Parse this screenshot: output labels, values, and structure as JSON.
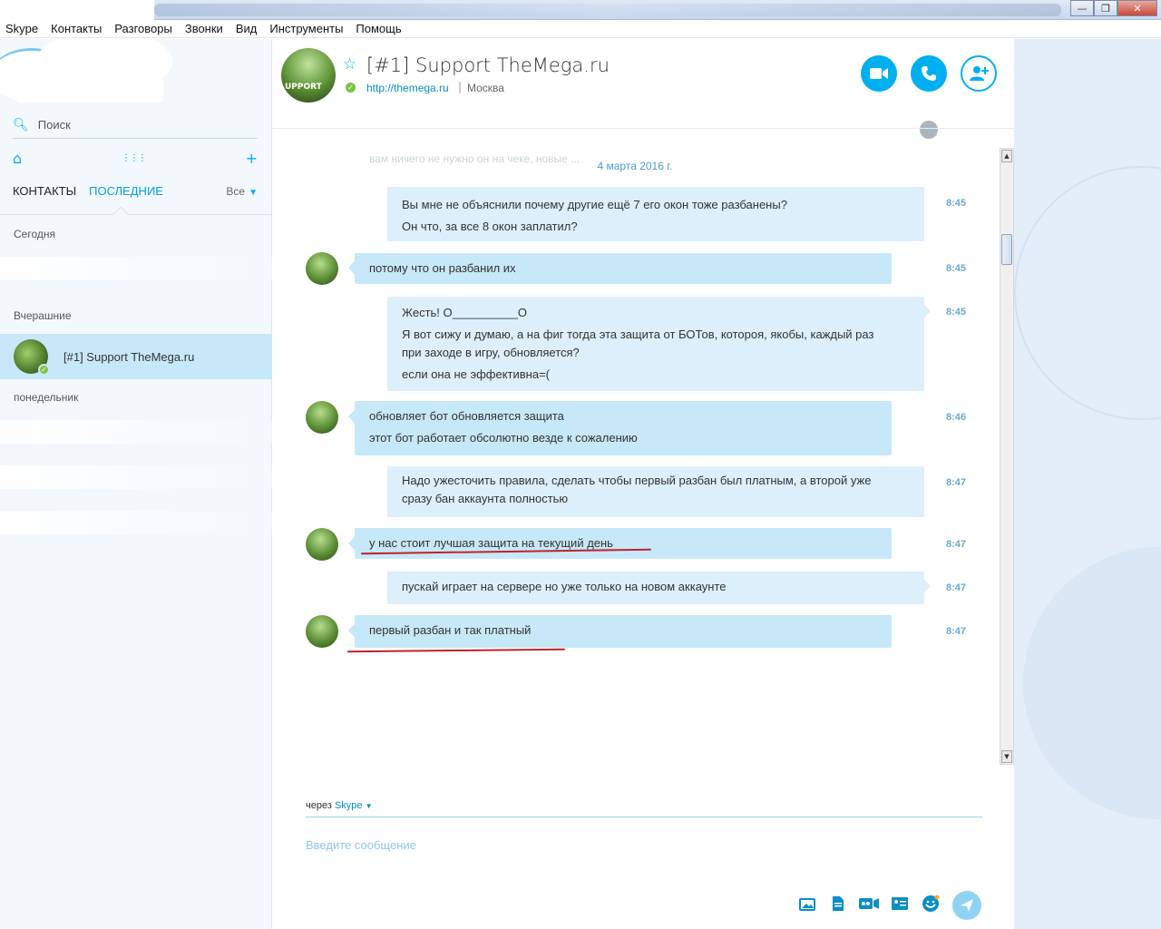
{
  "menu": [
    "Skype",
    "Контакты",
    "Разговоры",
    "Звонки",
    "Вид",
    "Инструменты",
    "Помощь"
  ],
  "window_buttons": {
    "minimize": "—",
    "restore": "❐",
    "close": "✕"
  },
  "sidebar": {
    "search_label": "Поиск",
    "tabs": [
      "КОНТАКТЫ",
      "ПОСЛЕДНИЕ"
    ],
    "active_tab": "ПОСЛЕДНИЕ",
    "filter": "Все",
    "groups": {
      "today": "Сегодня",
      "yesterday": "Вчерашние",
      "monday": "понедельник"
    },
    "selected_chat": {
      "name": "[#1] Support TheMega.ru"
    }
  },
  "header": {
    "title": "[#1] Support TheMega.ru",
    "link": "http://themega.ru",
    "separator": "|",
    "city": "Москва",
    "avatar_text": "UPPORT"
  },
  "chat": {
    "faded_line": "вам ничего не нужно он на чеке, новые ...",
    "date": "4 марта 2016 г.",
    "messages": [
      {
        "dir": "out",
        "time": "8:45",
        "lines": [
          "Вы мне не объяснили почему другие ещё 7 его окон тоже разбанены?",
          "Он что, за все 8 окон заплатил?"
        ]
      },
      {
        "dir": "in",
        "time": "8:45",
        "lines": [
          "потому что он разбанил их"
        ]
      },
      {
        "dir": "out",
        "time": "8:45",
        "lines": [
          "Жесть! О__________О",
          "Я вот сижу и думаю, а на фиг тогда эта защита от БОТов, котороя, якобы, каждый раз",
          "при заходе в игру, обновляется?",
          "если она не эффективна=("
        ]
      },
      {
        "dir": "in",
        "time": "8:46",
        "lines": [
          "обновляет бот обновляется защита",
          "этот бот работает обсолютно везде к сожалению"
        ]
      },
      {
        "dir": "out",
        "time": "8:47",
        "lines": [
          "Надо ужесточить правила, сделать чтобы первый разбан был платным, а второй уже",
          "сразу бан аккаунта полностью"
        ]
      },
      {
        "dir": "in",
        "time": "8:47",
        "lines": [
          "у нас стоит лучшая защита на текущий день"
        ]
      },
      {
        "dir": "out",
        "time": "8:47",
        "lines": [
          "пускай играет на сервере но уже только на новом аккаунте"
        ]
      },
      {
        "dir": "in",
        "time": "8:47",
        "lines": [
          "первый разбан и так платный"
        ]
      }
    ]
  },
  "composer": {
    "via": "через",
    "via_service": "Skype",
    "placeholder": "Введите сообщение"
  },
  "colors": {
    "accent": "#00aff0",
    "incoming": "#c7e8f8",
    "outgoing": "#dceffb",
    "annotation": "#c0222b",
    "online": "#7dc242"
  }
}
